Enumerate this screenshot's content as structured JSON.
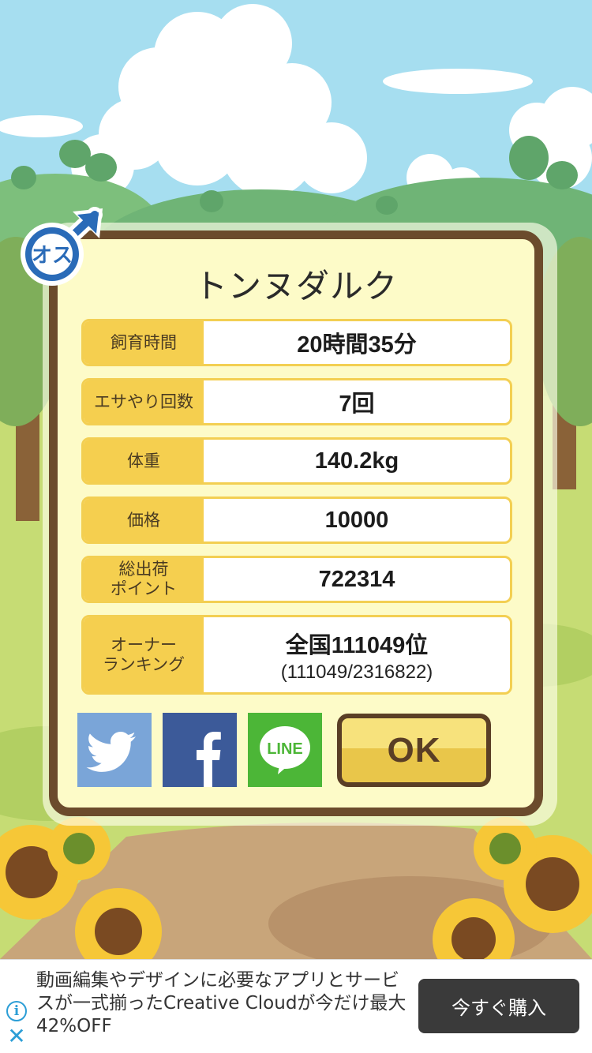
{
  "pet": {
    "name": "トンヌダルク",
    "gender_label": "オス"
  },
  "stats": [
    {
      "label": "飼育時間",
      "value": "20時間35分"
    },
    {
      "label": "エサやり回数",
      "value": "7回"
    },
    {
      "label": "体重",
      "value": "140.2kg"
    },
    {
      "label": "価格",
      "value": "10000"
    },
    {
      "label": "総出荷\nポイント",
      "value": "722314"
    },
    {
      "label": "オーナー\nランキング",
      "value": "全国111049位",
      "sub": "(111049/2316822)"
    }
  ],
  "share": {
    "line_label": "LINE"
  },
  "ok_label": "OK",
  "ad": {
    "text": "動画編集やデザインに必要なアプリとサービスが一式揃ったCreative Cloudが今だけ最大42%OFF",
    "cta": "今すぐ購入",
    "info_icon": "i",
    "close_icon": "✕"
  },
  "colors": {
    "dialog_border": "#6b4b2c",
    "dialog_bg": "#fdfbc8",
    "label_bg": "#f5cf4f",
    "ok_button": "#f7e27c",
    "gender_blue": "#2a6bb8"
  }
}
